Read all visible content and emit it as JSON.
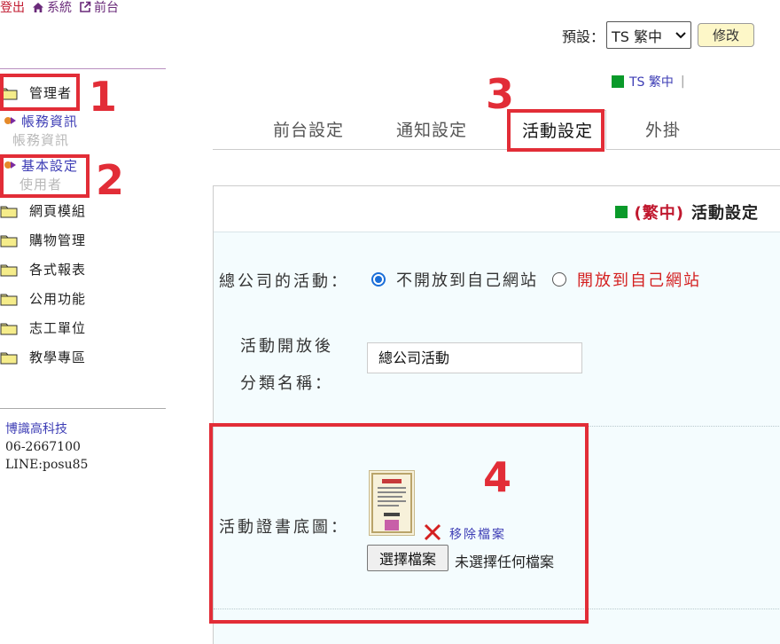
{
  "toplinks": {
    "logout": "登出",
    "system": "系統",
    "frontend": "前台"
  },
  "preset": {
    "label": "預設：",
    "selected": "TS 繁中",
    "modify": "修改"
  },
  "sidebar": {
    "items": [
      {
        "label": "管理者",
        "type": "folder"
      },
      {
        "label": "帳務資訊",
        "type": "link"
      },
      {
        "label": "帳務資訊",
        "type": "disabled"
      },
      {
        "label": "基本設定",
        "type": "link"
      },
      {
        "label": "使用者",
        "type": "disabled"
      },
      {
        "label": "網頁模組",
        "type": "folder"
      },
      {
        "label": "購物管理",
        "type": "folder"
      },
      {
        "label": "各式報表",
        "type": "folder"
      },
      {
        "label": "公用功能",
        "type": "folder"
      },
      {
        "label": "志工單位",
        "type": "folder"
      },
      {
        "label": "教學專區",
        "type": "folder"
      }
    ],
    "contact": {
      "company": "博識高科技",
      "phone": "06-2667100",
      "line": "LINE:posu85"
    }
  },
  "lang_indicator": {
    "label": "TS 繁中",
    "separator": "|"
  },
  "tabs": [
    {
      "label": "前台設定",
      "active": false
    },
    {
      "label": "通知設定",
      "active": false
    },
    {
      "label": "活動設定",
      "active": true
    },
    {
      "label": "外掛",
      "active": false
    }
  ],
  "panel": {
    "lang": "(繁中)",
    "title": "活動設定",
    "hq_label": "總公司的活動：",
    "radio_closed": "不開放到自己網站",
    "radio_open": "開放到自己網站",
    "radio_selected": "不開放到自己網站",
    "cat_label_1": "活動開放後",
    "cat_label_2": "分類名稱：",
    "cat_value": "總公司活動",
    "cert_label": "活動證書底圖：",
    "remove_file": "移除檔案",
    "choose_file": "選擇檔案",
    "no_file": "未選擇任何檔案"
  },
  "annotations": [
    "1",
    "2",
    "3",
    "4"
  ],
  "colors": {
    "annotation": "#e22d37",
    "accent_green": "#0a9a2a",
    "link": "#3d3db5",
    "panel_bg": "#f4fcfe",
    "button_yellow": "#fdf7c8"
  }
}
